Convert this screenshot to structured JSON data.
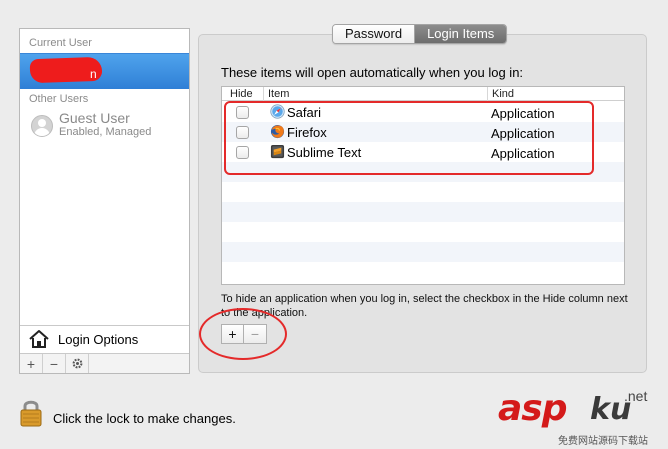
{
  "sidebar": {
    "current_user_label": "Current User",
    "current_user_name_visible": "n",
    "other_users_label": "Other Users",
    "guest": {
      "name": "Guest User",
      "status": "Enabled, Managed"
    },
    "login_options_label": "Login Options",
    "toolbar": {
      "add": "+",
      "remove": "−",
      "action": "gear-icon"
    }
  },
  "tabs": [
    {
      "label": "Password",
      "selected": false
    },
    {
      "label": "Login Items",
      "selected": true
    }
  ],
  "login_items": {
    "intro": "These items will open automatically when you log in:",
    "columns": {
      "hide": "Hide",
      "item": "Item",
      "kind": "Kind"
    },
    "rows": [
      {
        "name": "Safari",
        "kind": "Application",
        "hidden": false,
        "icon": "safari-icon"
      },
      {
        "name": "Firefox",
        "kind": "Application",
        "hidden": false,
        "icon": "firefox-icon"
      },
      {
        "name": "Sublime Text",
        "kind": "Application",
        "hidden": false,
        "icon": "sublime-text-icon"
      }
    ],
    "hint": "To hide an application when you log in, select the checkbox in the Hide column next to the application.",
    "add_button": "+",
    "remove_button": "−"
  },
  "footer": {
    "lock_text": "Click the lock to make changes."
  },
  "watermark": {
    "brand_red": "asp",
    "brand_dark": "ku",
    "domain": ".net",
    "tagline": "免费网站源码下载站"
  },
  "colors": {
    "selection_blue": "#3a8ee6",
    "annotation_red": "#e42a2a",
    "tab_selected": "#7a7a7a"
  }
}
